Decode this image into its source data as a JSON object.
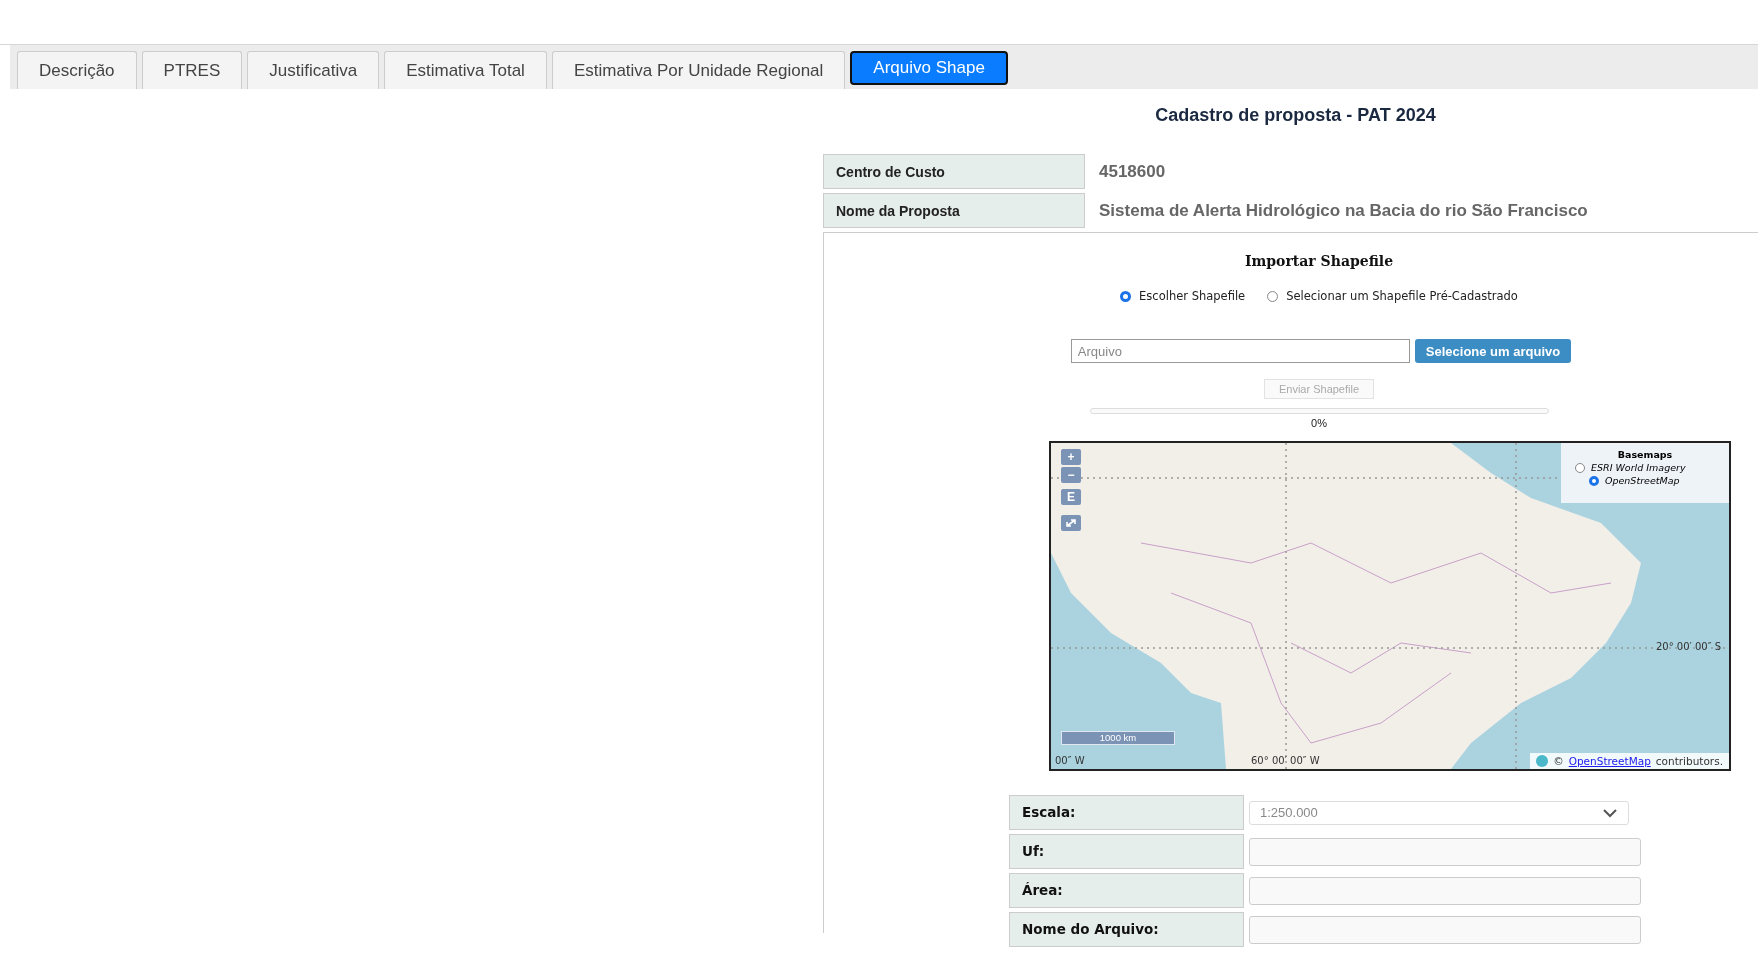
{
  "tabs": [
    {
      "label": "Descrição",
      "selected": false
    },
    {
      "label": "PTRES",
      "selected": false
    },
    {
      "label": "Justificativa",
      "selected": false
    },
    {
      "label": "Estimativa Total",
      "selected": false
    },
    {
      "label": "Estimativa Por Unidade Regional",
      "selected": false
    },
    {
      "label": "Arquivo Shape",
      "selected": true
    }
  ],
  "page_title": "Cadastro de proposta - PAT 2024",
  "info": [
    {
      "label": "Centro de Custo",
      "value": "4518600"
    },
    {
      "label": "Nome da Proposta",
      "value": "Sistema de Alerta Hidrológico na Bacia do rio São Francisco"
    }
  ],
  "import": {
    "title": "Importar Shapefile",
    "options": [
      {
        "label": "Escolher Shapefile",
        "selected": true
      },
      {
        "label": "Selecionar um Shapefile Pré-Cadastrado",
        "selected": false
      }
    ],
    "file_field": {
      "placeholder": "Arquivo"
    },
    "select_button": "Selecione um arquivo",
    "send_button": {
      "label": "Enviar Shapefile",
      "disabled": true
    },
    "progress": {
      "level": 0,
      "reading": "0%"
    }
  },
  "map": {
    "controls": [
      "+",
      "−",
      "E"
    ],
    "basemaps": {
      "title": "Basemaps",
      "options": [
        {
          "label": "ESRI World Imagery",
          "selected": false
        },
        {
          "label": "OpenStreetMap",
          "selected": true
        }
      ]
    },
    "grid_labels": [
      {
        "kind": "lon",
        "text": "00″ W"
      },
      {
        "kind": "lon",
        "text": "60° 00′ 00″ W"
      },
      {
        "kind": "lat",
        "text": "20° 00′ 00″ S"
      }
    ],
    "scale": "1000 km",
    "attribution": {
      "prefix": "©",
      "link": "OpenStreetMap",
      "suffix": "contributors."
    }
  },
  "form": [
    {
      "label": "Escala:",
      "kind": "select",
      "value": "1:250.000"
    },
    {
      "label": "Uf:",
      "kind": "text"
    },
    {
      "label": "Área:",
      "kind": "text"
    },
    {
      "label": "Nome do Arquivo:",
      "kind": "text"
    }
  ]
}
